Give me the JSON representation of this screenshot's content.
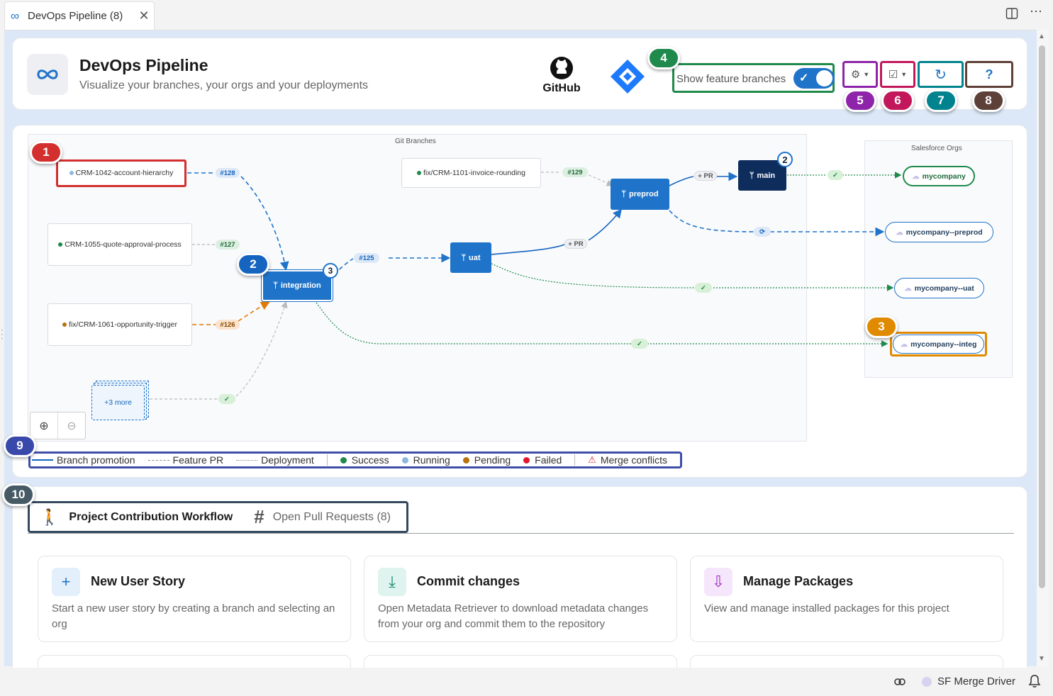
{
  "tab": {
    "title": "DevOps Pipeline (8)",
    "close": "✕"
  },
  "header": {
    "title": "DevOps Pipeline",
    "subtitle": "Visualize your branches, your orgs and your deployments",
    "github_label": "GitHub",
    "toggle_label": "Show feature branches",
    "toggle_on": true,
    "help_label": "?"
  },
  "badges": [
    "1",
    "2",
    "3",
    "4",
    "5",
    "6",
    "7",
    "8",
    "9",
    "10"
  ],
  "badge_colors": {
    "1": "#d32f2f",
    "2": "#1565c0",
    "3": "#e08a00",
    "4": "#1f8a4c",
    "5": "#8e24aa",
    "6": "#c2185b",
    "7": "#00838f",
    "8": "#5d4037",
    "9": "#3949ab",
    "10": "#455a64"
  },
  "diagram": {
    "git_title": "Git Branches",
    "sf_title": "Salesforce Orgs",
    "feature_branches": [
      {
        "label": "CRM-1042-account-hierarchy",
        "status_color": "#8fb8e0"
      },
      {
        "label": "CRM-1055-quote-approval-process",
        "status_color": "#1f8a4c"
      },
      {
        "label": "fix/CRM-1061-opportunity-trigger",
        "status_color": "#b8720e"
      },
      {
        "label": "fix/CRM-1101-invoice-rounding",
        "status_color": "#1f8a4c"
      }
    ],
    "more_label": "+3 more",
    "branches": {
      "integration": "integration",
      "uat": "uat",
      "preprod": "preprod",
      "main": "main"
    },
    "prs": {
      "p128": "#128",
      "p127": "#127",
      "p126": "#126",
      "p125": "#125",
      "p129": "#129"
    },
    "promote_label": "+ PR",
    "check": "✓",
    "sync": "⟳",
    "counts": {
      "integration": "3",
      "main": "2"
    },
    "orgs": [
      "mycompany",
      "mycompany--preprod",
      "mycompany--uat",
      "mycompany--integ"
    ]
  },
  "legend": {
    "branch_promotion": "Branch promotion",
    "feature_pr": "Feature PR",
    "deployment": "Deployment",
    "success": "Success",
    "running": "Running",
    "pending": "Pending",
    "failed": "Failed",
    "merge_conflicts": "Merge conflicts",
    "colors": {
      "success": "#1f8a4c",
      "running": "#8fb8e0",
      "pending": "#b8720e",
      "failed": "#e0182d"
    }
  },
  "workflow": {
    "tab1": "Project Contribution Workflow",
    "tab2": "Open Pull Requests (8)",
    "cards": [
      {
        "title": "New User Story",
        "desc": "Start a new user story by creating a branch and selecting an org",
        "icon": "plus-icon"
      },
      {
        "title": "Commit changes",
        "desc": "Open Metadata Retriever to download metadata changes from your org and commit them to the repository",
        "icon": "download-icon"
      },
      {
        "title": "Manage Packages",
        "desc": "View and manage installed packages for this project",
        "icon": "package-icon"
      }
    ]
  },
  "statusbar": {
    "merge_driver": "SF Merge Driver"
  }
}
